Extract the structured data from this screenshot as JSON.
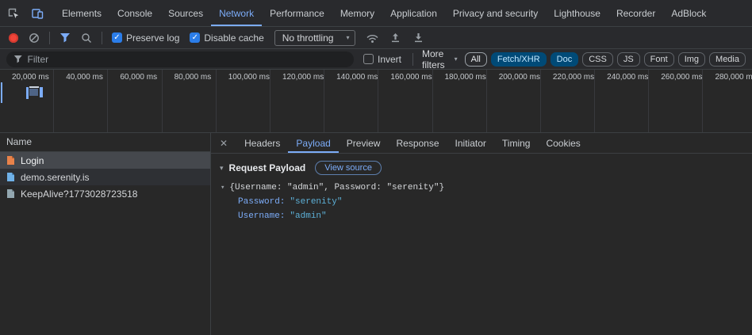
{
  "icons": {
    "check": "✓",
    "caret_down": "▾",
    "disclosure_open": "▾",
    "close": "✕"
  },
  "tabbar": {
    "active_tab": "Network",
    "tabs": [
      {
        "label": "Elements"
      },
      {
        "label": "Console"
      },
      {
        "label": "Sources"
      },
      {
        "label": "Network"
      },
      {
        "label": "Performance"
      },
      {
        "label": "Memory"
      },
      {
        "label": "Application"
      },
      {
        "label": "Privacy and security"
      },
      {
        "label": "Lighthouse"
      },
      {
        "label": "Recorder"
      },
      {
        "label": "AdBlock"
      }
    ]
  },
  "toolbar": {
    "preserve_log_label": "Preserve log",
    "preserve_log_checked": true,
    "disable_cache_label": "Disable cache",
    "disable_cache_checked": true,
    "throttling_value": "No throttling"
  },
  "filterbar": {
    "filter_placeholder": "Filter",
    "invert_label": "Invert",
    "invert_checked": false,
    "more_filters_label": "More filters",
    "chips": [
      "All",
      "Fetch/XHR",
      "Doc",
      "CSS",
      "JS",
      "Font",
      "Img",
      "Media"
    ],
    "selected_chips": [
      "Fetch/XHR",
      "Doc"
    ]
  },
  "overview": {
    "time_labels": [
      "20,000 ms",
      "40,000 ms",
      "60,000 ms",
      "80,000 ms",
      "100,000 ms",
      "120,000 ms",
      "140,000 ms",
      "160,000 ms",
      "180,000 ms",
      "200,000 ms",
      "220,000 ms",
      "240,000 ms",
      "260,000 ms",
      "280,000 ms"
    ]
  },
  "requests": {
    "name_header": "Name",
    "rows": [
      {
        "name": "Login",
        "selected": true
      },
      {
        "name": "demo.serenity.is",
        "selected": false
      },
      {
        "name": "KeepAlive?1773028723518",
        "selected": false
      }
    ]
  },
  "details": {
    "active_tab": "Payload",
    "tabs": [
      "Headers",
      "Payload",
      "Preview",
      "Response",
      "Initiator",
      "Timing",
      "Cookies"
    ],
    "section_title": "Request Payload",
    "view_source_label": "View source",
    "payload_preview": "{Username: \"admin\", Password: \"serenity\"}",
    "entries": [
      {
        "key": "Password:",
        "value": "\"serenity\""
      },
      {
        "key": "Username:",
        "value": "\"admin\""
      }
    ]
  },
  "colors": {
    "accent_blue": "#7cacf8",
    "chip_selected_bg": "#004a77",
    "chip_selected_text": "#c2e7ff",
    "key_blue": "#7cacf8",
    "string_cyan": "#5db0d7",
    "record_red": "#f0453a",
    "selected_row_bg": "#45484d"
  }
}
